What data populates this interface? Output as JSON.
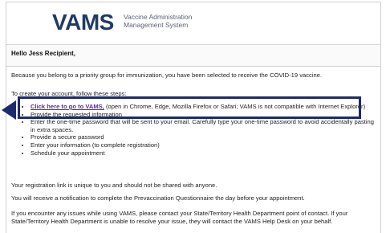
{
  "header": {
    "logo_text": "VAMS",
    "subtitle_line1": "Vaccine Administration",
    "subtitle_line2": "Management System"
  },
  "greeting": "Hello Jess Recipient,",
  "intro": "Because you belong to a priority group for immunization, you have been selected to receive the COVID-19 vaccine.",
  "steps_intro": "To create your account, follow these steps:",
  "steps": [
    {
      "link": "Click here to go to VAMS,",
      "text": " (open in Chrome, Edge, Mozilla Firefox or Safari; VAMS is not compatible with Internet Explorer)"
    },
    {
      "text": "Provide the requested information"
    },
    {
      "text": "Enter the one-time password that will be sent to your email. Carefully type your one-time password to avoid accidentally pasting in extra spaces."
    },
    {
      "text": "Provide a secure password"
    },
    {
      "text": "Enter your information (to complete registration)"
    },
    {
      "text": "Schedule your appointment"
    }
  ],
  "unique_note": "Your registration link is unique to you and should not be shared with anyone.",
  "notification_note": "You will receive a notification to complete the Prevaccination Questionnaire the day before your appointment.",
  "issues_note": "If you encounter any issues while using VAMS, please contact your State/Territory Health Department point of contact. If your State/Territory Health Department is unable to resolve your issue, they will contact the VAMS Help Desk on your behalf.",
  "colors": {
    "callout": "#1d2a6e",
    "link": "#5b2aa0",
    "logo": "#1f3b66"
  }
}
